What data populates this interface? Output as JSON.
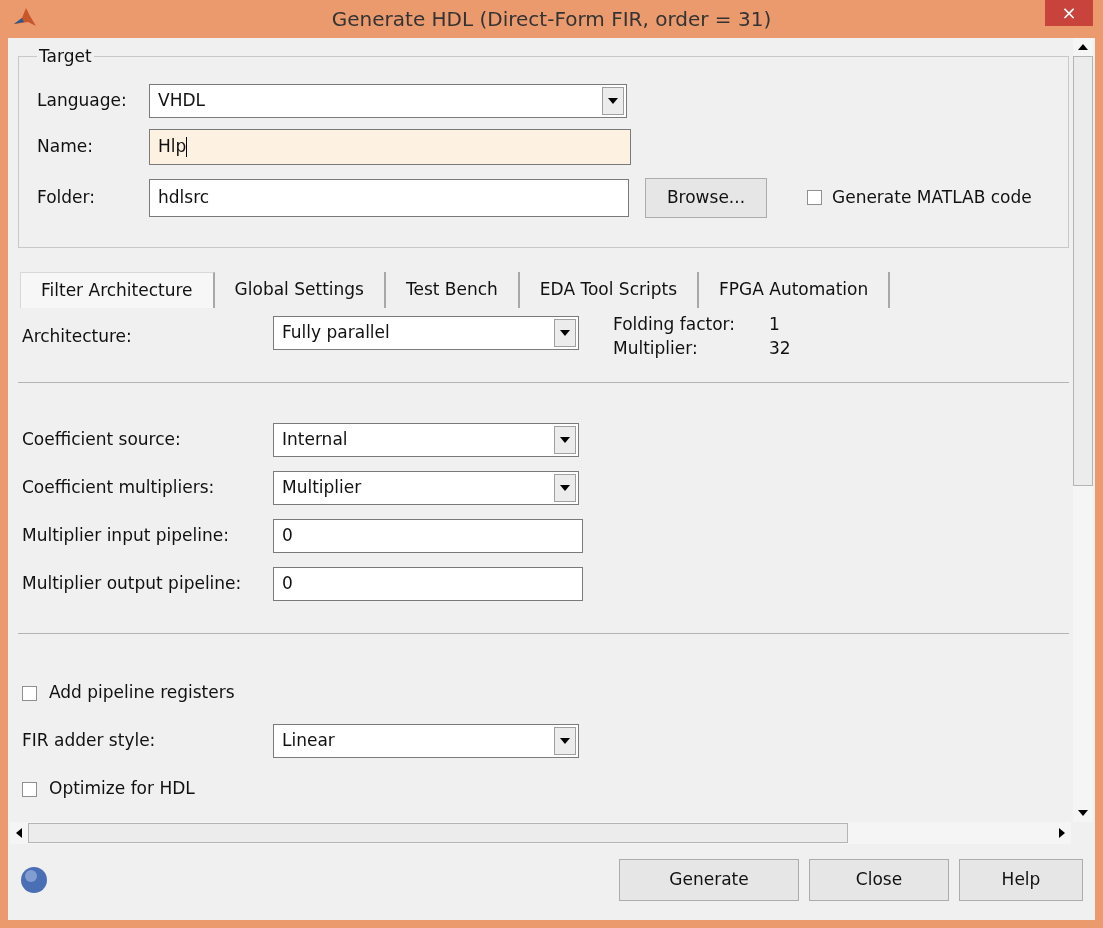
{
  "window": {
    "title": "Generate HDL (Direct-Form FIR, order = 31)",
    "close": "×"
  },
  "target": {
    "legend": "Target",
    "language": {
      "label": "Language:",
      "value": "VHDL"
    },
    "name": {
      "label": "Name:",
      "value": "Hlp",
      "focused": true
    },
    "folder": {
      "label": "Folder:",
      "value": "hdlsrc",
      "button": "Browse..."
    },
    "generate_matlab": {
      "label": "Generate MATLAB code",
      "checked": false
    }
  },
  "tabs": [
    {
      "label": "Filter Architecture",
      "selected": true
    },
    {
      "label": "Global Settings",
      "selected": false
    },
    {
      "label": "Test Bench",
      "selected": false
    },
    {
      "label": "EDA Tool Scripts",
      "selected": false
    },
    {
      "label": "FPGA Automation",
      "selected": false
    }
  ],
  "architecture": {
    "label": "Architecture:",
    "value": "Fully parallel",
    "info": [
      {
        "label": "Folding factor:",
        "value": "1"
      },
      {
        "label": "Multiplier:",
        "value": "32"
      }
    ]
  },
  "sections": [
    [
      {
        "kind": "dropdown",
        "label": "Coefficient source:",
        "value": "Internal"
      },
      {
        "kind": "dropdown",
        "label": "Coefficient multipliers:",
        "value": "Multiplier"
      },
      {
        "kind": "text",
        "label": "Multiplier input pipeline:",
        "value": "0"
      },
      {
        "kind": "text",
        "label": "Multiplier output pipeline:",
        "value": "0"
      }
    ],
    [
      {
        "kind": "checkbox",
        "label": "Add pipeline registers",
        "checked": false
      },
      {
        "kind": "dropdown",
        "label": "FIR adder style:",
        "value": "Linear"
      },
      {
        "kind": "checkbox",
        "label": "Optimize for HDL",
        "checked": false
      }
    ]
  ],
  "buttons": [
    "Generate",
    "Close",
    "Help"
  ]
}
